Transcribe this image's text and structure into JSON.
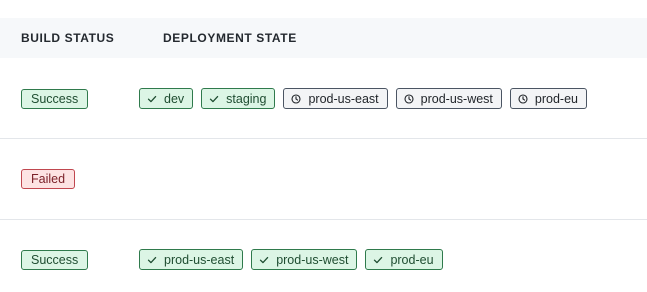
{
  "columns": {
    "build_status": "BUILD STATUS",
    "deployment_state": "DEPLOYMENT STATE"
  },
  "rows": [
    {
      "status": "Success",
      "status_kind": "success",
      "deployments": [
        {
          "label": "dev",
          "state": "deployed",
          "icon": "check-icon"
        },
        {
          "label": "staging",
          "state": "deployed",
          "icon": "check-icon"
        },
        {
          "label": "prod-us-east",
          "state": "pending",
          "icon": "clock-icon"
        },
        {
          "label": "prod-us-west",
          "state": "pending",
          "icon": "clock-icon"
        },
        {
          "label": "prod-eu",
          "state": "pending",
          "icon": "clock-icon"
        }
      ]
    },
    {
      "status": "Failed",
      "status_kind": "failed",
      "deployments": []
    },
    {
      "status": "Success",
      "status_kind": "success",
      "deployments": [
        {
          "label": "prod-us-east",
          "state": "deployed",
          "icon": "check-icon"
        },
        {
          "label": "prod-us-west",
          "state": "deployed",
          "icon": "check-icon"
        },
        {
          "label": "prod-eu",
          "state": "deployed",
          "icon": "check-icon"
        }
      ]
    }
  ],
  "colors": {
    "success_bg": "#dcf5e5",
    "success_border": "#2f7a4c",
    "failed_bg": "#fde3e3",
    "failed_border": "#c0474f",
    "pending_bg": "#f3f4f6",
    "pending_border": "#4b5563"
  }
}
